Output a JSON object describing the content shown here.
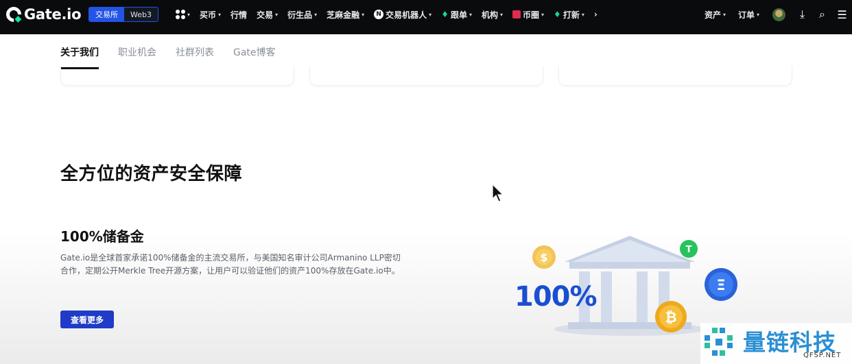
{
  "nav": {
    "logo_text": "Gate.io",
    "segments": [
      "交易所",
      "Web3"
    ],
    "items": [
      {
        "label": "买币",
        "caret": "▾"
      },
      {
        "label": "行情",
        "caret": ""
      },
      {
        "label": "交易",
        "caret": "▾"
      },
      {
        "label": "衍生品",
        "caret": "▾"
      },
      {
        "label": "芝麻金融",
        "caret": "▾"
      },
      {
        "label": "交易机器人",
        "caret": "▾"
      },
      {
        "label": "跟单",
        "caret": "▾"
      },
      {
        "label": "机构",
        "caret": "▾"
      },
      {
        "label": "币圈",
        "caret": "▾"
      },
      {
        "label": "打新",
        "caret": "▾"
      }
    ],
    "more_glyph": "›",
    "right_items": [
      {
        "label": "资产",
        "caret": "▾"
      },
      {
        "label": "订单",
        "caret": "▾"
      }
    ]
  },
  "tabs": [
    "关于我们",
    "职业机会",
    "社群列表",
    "Gate博客"
  ],
  "section": {
    "title": "全方位的资产安全保障",
    "subtitle": "100%储备金",
    "description": "Gate.io是全球首家承诺100%储备金的主流交易所，与美国知名审计公司Armanino LLP密切合作，定期公开Merkle Tree开源方案，让用户可以验证他们的资产100%存放在Gate.io中。",
    "button": "查看更多"
  },
  "illustration": {
    "percent": "100%",
    "coins": [
      "$",
      "₿",
      "T",
      "Ξ"
    ]
  },
  "watermark": {
    "text": "量链科技",
    "sub": "QFSP.NET"
  },
  "colors": {
    "nav_bg": "#0a0b0d",
    "brand_blue": "#1f3bc8",
    "percent_blue": "#1a4fd0",
    "accent_green": "#17e6a1"
  }
}
